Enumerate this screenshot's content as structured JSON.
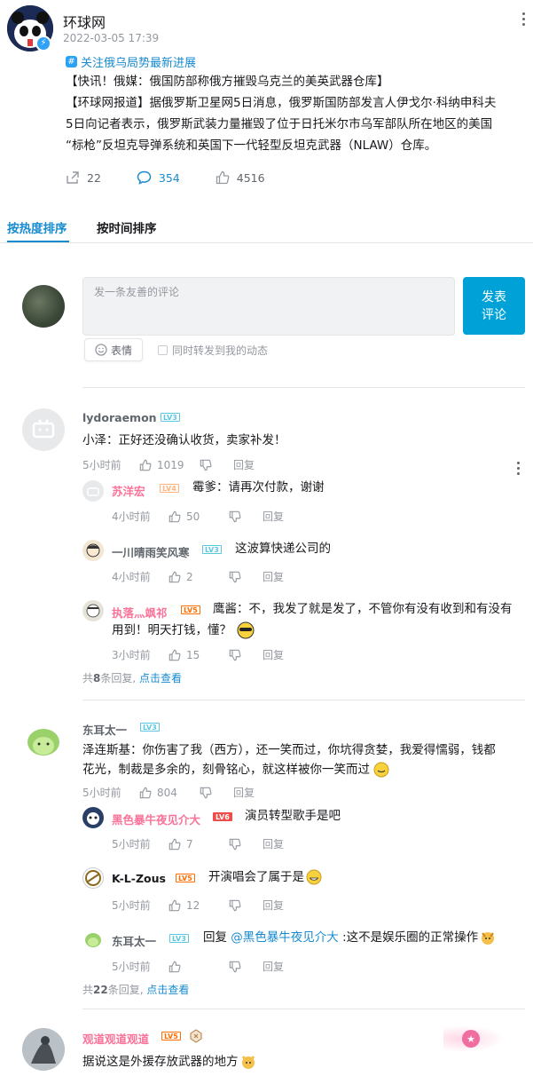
{
  "post": {
    "author": "环球网",
    "time": "2022-03-05 17:39",
    "topic": "关注俄乌局势最新进展",
    "topic_icon": "hash-icon",
    "text_line1": "【快讯！俄媒：俄国防部称俄方摧毁乌克兰的美英武器仓库】",
    "text_line2": "【环球网报道】据俄罗斯卫星网5日消息，俄罗斯国防部发言人伊戈尔·科纳申科夫",
    "text_line3": "5日向记者表示，俄罗斯武装力量摧毁了位于日托米尔市乌军部队所在地区的美国",
    "text_line4": "“标枪”反坦克导弹系统和英国下一代轻型反坦克武器（NLAW）仓库。",
    "forwards": "22",
    "comments": "354",
    "likes": "4516"
  },
  "tabs": [
    "按热度排序",
    "按时间排序"
  ],
  "composer": {
    "placeholder": "发一条友善的评论",
    "post_btn_line1": "发表",
    "post_btn_line2": "评论",
    "emoji_label": "表情",
    "forward_label": "同时转发到我的动态"
  },
  "comments": [
    {
      "user": "lydoraemon",
      "level": "LV3",
      "text": "小泽：正好还没确认收货，卖家补发！",
      "time": "5小时前",
      "likes": "1019",
      "reply": "回复",
      "replies": [
        {
          "user": "苏洋宏",
          "level": "LV4",
          "text": "霉爹：请再次付款，谢谢",
          "time": "4小时前",
          "likes": "50",
          "reply": "回复"
        },
        {
          "user": "一川晴雨笑风寒",
          "level": "LV3",
          "text": "这波算快递公司的",
          "time": "4小时前",
          "likes": "2",
          "reply": "回复"
        },
        {
          "user": "执落灬飒祁",
          "level": "LV5",
          "text_line1": "鹰酱：不，我发了就是发了，不管你有没有收到和有没有",
          "text_line2": "用到！明天打钱，懂？",
          "time": "3小时前",
          "likes": "15",
          "reply": "回复"
        }
      ],
      "more_prefix": "共",
      "more_count": "8",
      "more_suffix": "条回复,",
      "more_link": "点击查看"
    },
    {
      "user": "东耳太一",
      "level": "LV3",
      "text_line1": "泽连斯基：你伤害了我（西方），还一笑而过，你坑得贪婪，我爱得懦弱，钱都",
      "text_line2": "花光，制裁是多余的，刻骨铭心，就这样被你一笑而过",
      "time": "5小时前",
      "likes": "804",
      "reply": "回复",
      "replies": [
        {
          "user": "黑色暴牛夜见介大",
          "level": "LV6",
          "text": "演员转型歌手是吧",
          "time": "5小时前",
          "likes": "7",
          "reply": "回复"
        },
        {
          "user": "K-L-Zous",
          "level": "LV5",
          "text": "开演唱会了属于是",
          "time": "5小时前",
          "likes": "12",
          "reply": "回复"
        },
        {
          "user": "东耳太一",
          "level": "LV3",
          "text_pre": "回复 ",
          "mention": "@黑色暴牛夜见介大",
          "text_post": " :这不是娱乐圈的正常操作",
          "time": "5小时前",
          "likes": "",
          "reply": "回复"
        }
      ],
      "more_prefix": "共",
      "more_count": "22",
      "more_suffix": "条回复,",
      "more_link": "点击查看"
    },
    {
      "user": "观道观道观道",
      "level": "LV5",
      "text": "据说这是外援存放武器的地方"
    }
  ],
  "colors": {
    "accent": "#00a1d6",
    "link": "#178bcf",
    "pink": "#fb7299"
  }
}
